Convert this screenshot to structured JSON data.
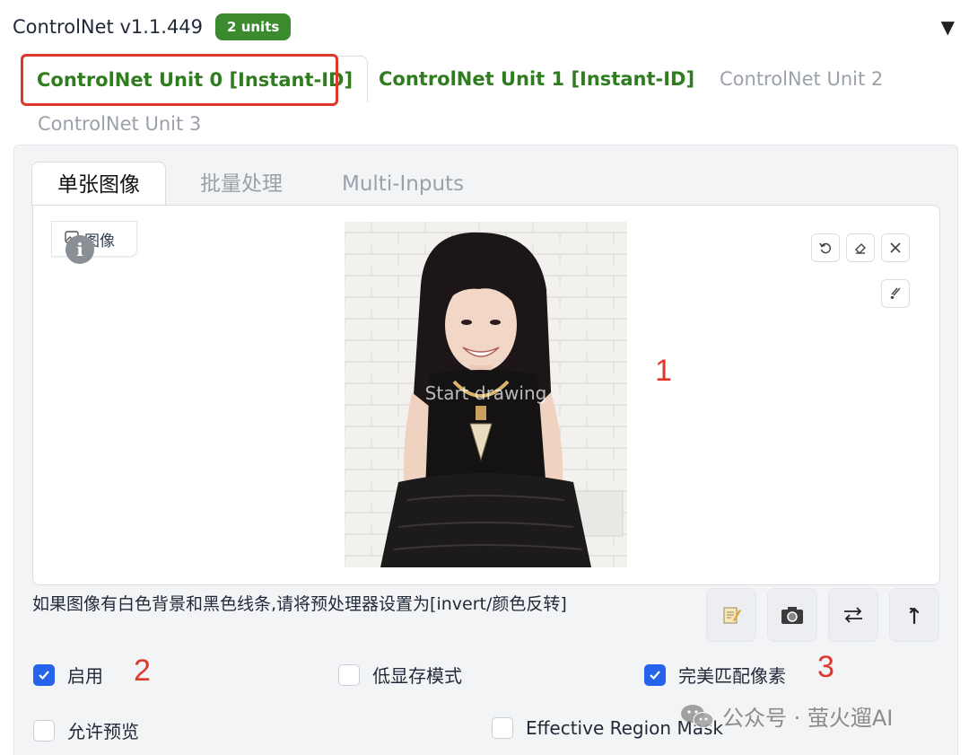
{
  "header": {
    "title": "ControlNet v1.1.449",
    "badge": "2 units",
    "collapse_icon": "triangle-down-icon"
  },
  "unit_tabs": [
    {
      "label": "ControlNet Unit 0 [Instant-ID]",
      "active": true
    },
    {
      "label": "ControlNet Unit 1 [Instant-ID]",
      "active": false
    },
    {
      "label": "ControlNet Unit 2",
      "active": false
    },
    {
      "label": "ControlNet Unit 3",
      "active": false
    }
  ],
  "sub_tabs": [
    {
      "label": "单张图像",
      "active": true
    },
    {
      "label": "批量处理",
      "active": false
    },
    {
      "label": "Multi-Inputs",
      "active": false
    }
  ],
  "image_input": {
    "label": "图像",
    "placeholder": "Start drawing",
    "tools": [
      "undo-icon",
      "eraser-icon",
      "close-icon",
      "brush-icon"
    ]
  },
  "annotations": {
    "a1": "1",
    "a2": "2",
    "a3": "3"
  },
  "hint": "如果图像有白色背景和黑色线条,请将预处理器设置为[invert/颜色反转]",
  "action_buttons": [
    "memo-icon",
    "camera-icon",
    "swap-icon",
    "upload-arrow-icon"
  ],
  "checkboxes": {
    "enable": {
      "label": "启用",
      "checked": true
    },
    "low_vram": {
      "label": "低显存模式",
      "checked": false
    },
    "pixel_perfect": {
      "label": "完美匹配像素",
      "checked": true
    },
    "allow_preview": {
      "label": "允许预览",
      "checked": false
    },
    "effective_region_mask": {
      "label": "Effective Region Mask",
      "checked": false
    }
  },
  "watermark": "公众号 · 萤火遛AI",
  "colors": {
    "accent_green": "#2f7d1f",
    "badge_green": "#3b8a2e",
    "checkbox_blue": "#2563eb",
    "annotation_red": "#e0372c"
  }
}
